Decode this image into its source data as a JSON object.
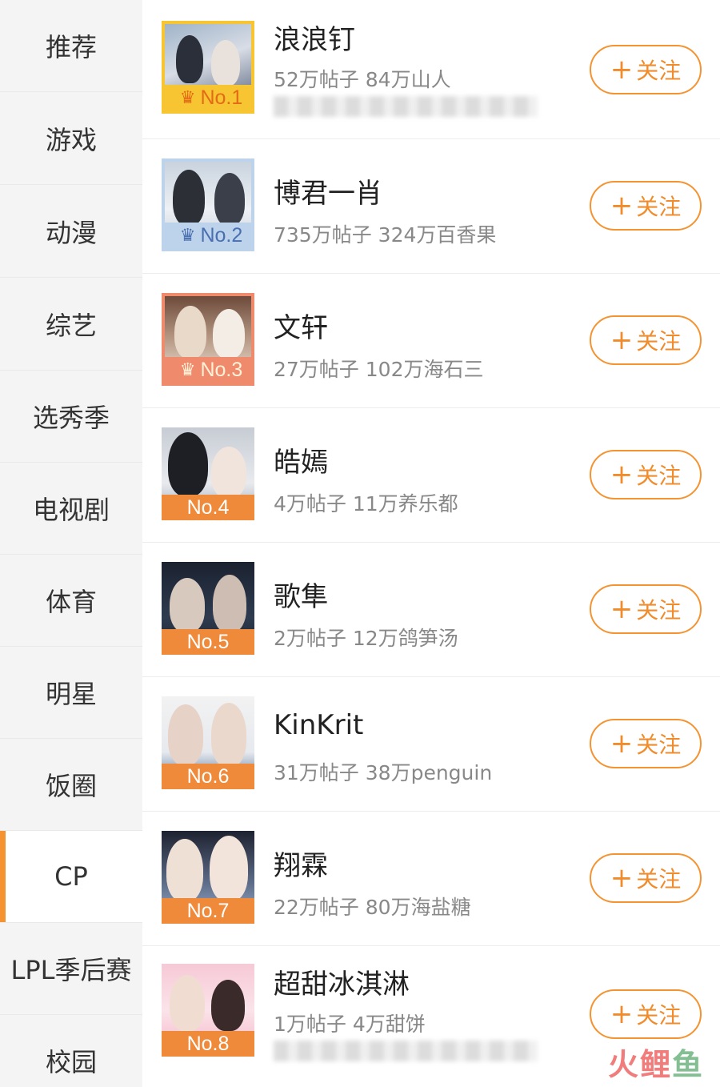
{
  "sidebar": {
    "items": [
      {
        "label": "推荐",
        "active": false
      },
      {
        "label": "游戏",
        "active": false
      },
      {
        "label": "动漫",
        "active": false
      },
      {
        "label": "综艺",
        "active": false
      },
      {
        "label": "选秀季",
        "active": false
      },
      {
        "label": "电视剧",
        "active": false
      },
      {
        "label": "体育",
        "active": false
      },
      {
        "label": "明星",
        "active": false
      },
      {
        "label": "饭圈",
        "active": false
      },
      {
        "label": "CP",
        "active": true
      },
      {
        "label": "LPL季后赛",
        "active": false
      },
      {
        "label": "校园",
        "active": false
      }
    ]
  },
  "list": {
    "items": [
      {
        "rank": "No.1",
        "crown": "gold",
        "title": "浪浪钉",
        "stats": "52万帖子 84万山人",
        "has_blur_line": true,
        "follow_label": "关注"
      },
      {
        "rank": "No.2",
        "crown": "silver",
        "title": "博君一肖",
        "stats": "735万帖子 324万百香果",
        "has_blur_line": false,
        "follow_label": "关注"
      },
      {
        "rank": "No.3",
        "crown": "bronze",
        "title": "文轩",
        "stats": "27万帖子 102万海石三",
        "has_blur_line": false,
        "follow_label": "关注"
      },
      {
        "rank": "No.4",
        "crown": "none",
        "title": "皓嫣",
        "stats": "4万帖子 11万养乐都",
        "has_blur_line": false,
        "follow_label": "关注"
      },
      {
        "rank": "No.5",
        "crown": "none",
        "title": "歌隼",
        "stats": "2万帖子 12万鸽笋汤",
        "has_blur_line": false,
        "follow_label": "关注"
      },
      {
        "rank": "No.6",
        "crown": "none",
        "title": "KinKrit",
        "stats": "31万帖子 38万penguin",
        "has_blur_line": false,
        "follow_label": "关注"
      },
      {
        "rank": "No.7",
        "crown": "none",
        "title": "翔霖",
        "stats": "22万帖子 80万海盐糖",
        "has_blur_line": false,
        "follow_label": "关注"
      },
      {
        "rank": "No.8",
        "crown": "none",
        "title": "超甜冰淇淋",
        "stats": "1万帖子 4万甜饼",
        "has_blur_line": true,
        "follow_label": "关注"
      }
    ]
  },
  "colors": {
    "accent": "#f59331",
    "gold_frame": "#f7c531",
    "silver_frame": "#bdd3ec",
    "bronze_frame": "#f08a6c",
    "rank_orange": "#ef8a3a"
  },
  "watermark": {
    "text": "火鲤鱼"
  },
  "icons": {
    "crown": "crown-icon",
    "plus": "plus-icon"
  }
}
